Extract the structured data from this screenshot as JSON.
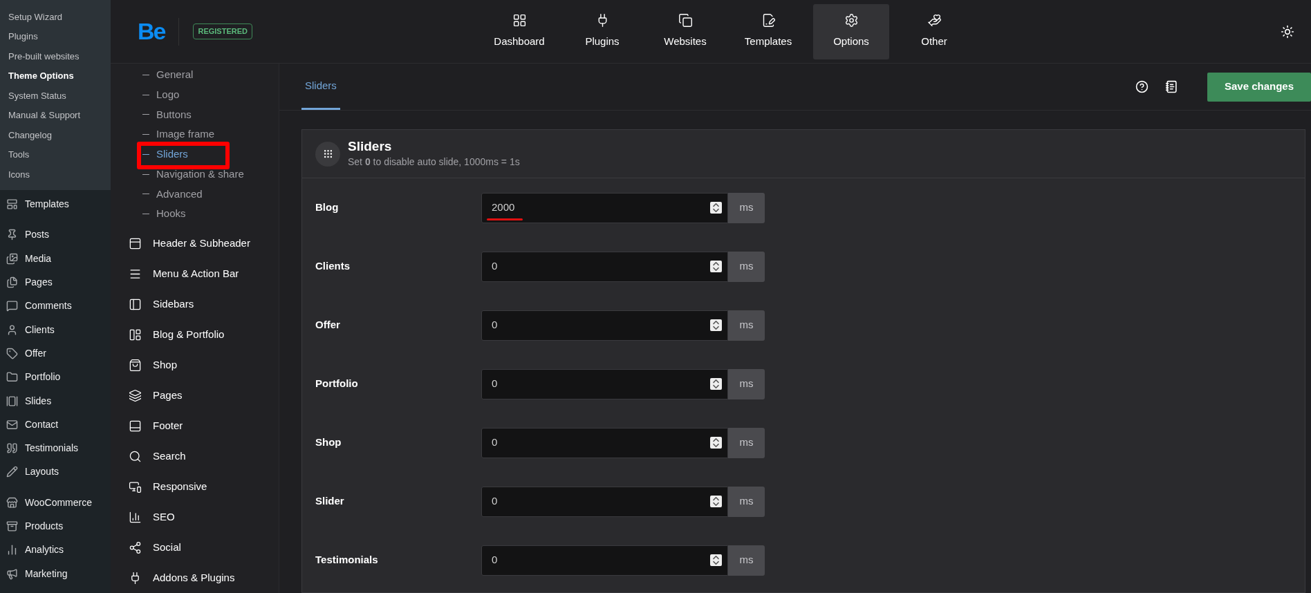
{
  "wp_submenu": [
    {
      "label": "Setup Wizard",
      "selected": false
    },
    {
      "label": "Plugins",
      "selected": false
    },
    {
      "label": "Pre-built websites",
      "selected": false
    },
    {
      "label": "Theme Options",
      "selected": true
    },
    {
      "label": "System Status",
      "selected": false
    },
    {
      "label": "Manual & Support",
      "selected": false
    },
    {
      "label": "Changelog",
      "selected": false
    },
    {
      "label": "Tools",
      "selected": false
    },
    {
      "label": "Icons",
      "selected": false
    }
  ],
  "wp_menu_groups": [
    [
      "Templates"
    ],
    [
      "Posts",
      "Media",
      "Pages",
      "Comments",
      "Clients",
      "Offer",
      "Portfolio",
      "Slides",
      "Contact",
      "Testimonials",
      "Layouts"
    ],
    [
      "WooCommerce",
      "Products",
      "Analytics",
      "Marketing"
    ]
  ],
  "logo": {
    "text": "Be",
    "badge": "REGISTERED"
  },
  "top_nav": [
    {
      "label": "Dashboard",
      "selected": false
    },
    {
      "label": "Plugins",
      "selected": false
    },
    {
      "label": "Websites",
      "selected": false
    },
    {
      "label": "Templates",
      "selected": false
    },
    {
      "label": "Options",
      "selected": true
    },
    {
      "label": "Other",
      "selected": false
    }
  ],
  "options_sidebar": {
    "sub_items": [
      {
        "label": "General",
        "selected": false
      },
      {
        "label": "Logo",
        "selected": false
      },
      {
        "label": "Buttons",
        "selected": false
      },
      {
        "label": "Image frame",
        "selected": false
      },
      {
        "label": "Sliders",
        "selected": true
      },
      {
        "label": "Navigation & share",
        "selected": false
      },
      {
        "label": "Advanced",
        "selected": false
      },
      {
        "label": "Hooks",
        "selected": false
      }
    ],
    "sections": [
      "Header & Subheader",
      "Menu & Action Bar",
      "Sidebars",
      "Blog & Portfolio",
      "Shop",
      "Pages",
      "Footer",
      "Search",
      "Responsive",
      "SEO",
      "Social",
      "Addons & Plugins"
    ]
  },
  "content_tabs": [
    {
      "label": "Sliders",
      "selected": true
    }
  ],
  "save_button": "Save changes",
  "panel": {
    "title": "Sliders",
    "description": "Set **0** to disable auto slide, 1000ms = 1s",
    "fields": [
      {
        "label": "Blog",
        "value": "2000",
        "unit": "ms"
      },
      {
        "label": "Clients",
        "value": "0",
        "unit": "ms"
      },
      {
        "label": "Offer",
        "value": "0",
        "unit": "ms"
      },
      {
        "label": "Portfolio",
        "value": "0",
        "unit": "ms"
      },
      {
        "label": "Shop",
        "value": "0",
        "unit": "ms"
      },
      {
        "label": "Slider",
        "value": "0",
        "unit": "ms"
      },
      {
        "label": "Testimonials",
        "value": "0",
        "unit": "ms"
      }
    ]
  }
}
